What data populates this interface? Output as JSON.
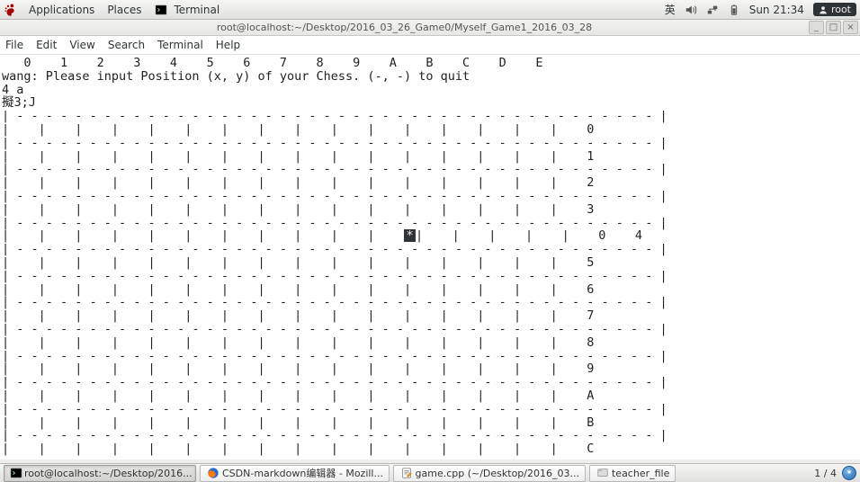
{
  "top": {
    "apps": "Applications",
    "places": "Places",
    "terminal": "Terminal",
    "ime": "英",
    "clock": "Sun 21:34",
    "user": "root"
  },
  "window": {
    "title": "root@localhost:~/Desktop/2016_03_26_Game0/Myself_Game1_2016_03_28",
    "menu": {
      "file": "File",
      "edit": "Edit",
      "view": "View",
      "search": "Search",
      "terminal": "Terminal",
      "help": "Help"
    }
  },
  "term": {
    "header": "   0    1    2    3    4    5    6    7    8    9    A    B    C    D    E",
    "prompt": "wang: Please input Position (x, y) of your Chess. (-, -) to quit",
    "input": "4 a",
    "esc": "擬3;J",
    "sep": "| - - - - - - - - - - - - - - - - - - - - - - - - - - - - - - - - - - - - - - - - - - - - |",
    "row_pre": "|    |    |    |    |    |    |    |    |    |    |    ",
    "piece": "*",
    "row_post": "|    |    |    |    |    0",
    "row_full": "|    |    |    |    |    |    |    |    |    |    |    |    |    |    |    |    ",
    "rlab": {
      "r0": "0",
      "r1": "1",
      "r2": "2",
      "r3": "3",
      "r4": "4",
      "r5": "5",
      "r6": "6",
      "r7": "7",
      "r8": "8",
      "r9": "9",
      "ra": "A",
      "rb": "B",
      "rc": "C"
    }
  },
  "tasks": {
    "t1": "root@localhost:~/Desktop/2016...",
    "t2": "CSDN-markdown编辑器 - Mozill...",
    "t3": "game.cpp (~/Desktop/2016_03...",
    "t4": "teacher_file"
  },
  "workspace": "1 / 4"
}
